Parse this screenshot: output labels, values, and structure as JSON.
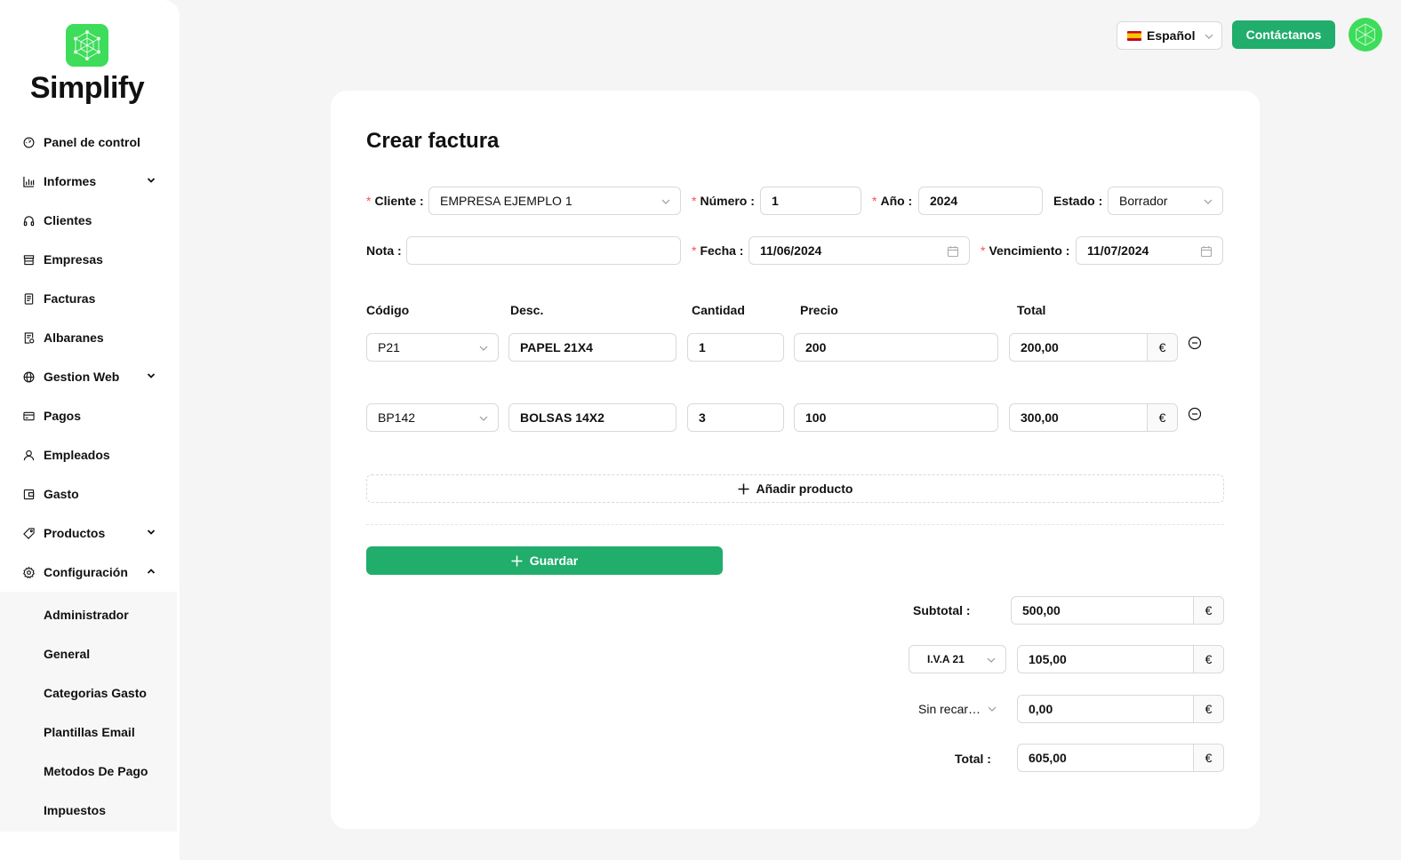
{
  "app": {
    "name": "Simplify"
  },
  "sidebar": {
    "items": [
      {
        "label": "Panel de control",
        "icon": "dashboard-icon",
        "expandable": false
      },
      {
        "label": "Informes",
        "icon": "bar-chart-icon",
        "expandable": true
      },
      {
        "label": "Clientes",
        "icon": "headphones-icon",
        "expandable": false
      },
      {
        "label": "Empresas",
        "icon": "shop-icon",
        "expandable": false
      },
      {
        "label": "Facturas",
        "icon": "invoice-icon",
        "expandable": false
      },
      {
        "label": "Albaranes",
        "icon": "delivery-note-icon",
        "expandable": false
      },
      {
        "label": "Gestion Web",
        "icon": "globe-icon",
        "expandable": true
      },
      {
        "label": "Pagos",
        "icon": "credit-card-icon",
        "expandable": false
      },
      {
        "label": "Empleados",
        "icon": "user-icon",
        "expandable": false
      },
      {
        "label": "Gasto",
        "icon": "wallet-icon",
        "expandable": false
      },
      {
        "label": "Productos",
        "icon": "tag-icon",
        "expandable": true
      },
      {
        "label": "Configuración",
        "icon": "settings-icon",
        "expandable": true,
        "expanded": true
      }
    ],
    "submenu": [
      "Administrador",
      "General",
      "Categorias Gasto",
      "Plantillas Email",
      "Metodos De Pago",
      "Impuestos"
    ]
  },
  "topbar": {
    "language": "Español",
    "contact_label": "Contáctanos"
  },
  "form": {
    "title": "Crear factura",
    "cliente_label": "Cliente",
    "cliente_value": "EMPRESA EJEMPLO 1",
    "numero_label": "Número",
    "numero_value": "1",
    "anio_label": "Año",
    "anio_value": "2024",
    "estado_label": "Estado",
    "estado_value": "Borrador",
    "nota_label": "Nota",
    "nota_value": "",
    "fecha_label": "Fecha",
    "fecha_value": "11/06/2024",
    "vencimiento_label": "Vencimiento",
    "vencimiento_value": "11/07/2024",
    "colon": ":"
  },
  "lines": {
    "headers": {
      "codigo": "Código",
      "desc": "Desc.",
      "cantidad": "Cantidad",
      "precio": "Precio",
      "total": "Total"
    },
    "rows": [
      {
        "codigo": "P21",
        "desc": "PAPEL 21X4",
        "cantidad": "1",
        "precio": "200",
        "total": "200,00"
      },
      {
        "codigo": "BP142",
        "desc": "BOLSAS 14X2",
        "cantidad": "3",
        "precio": "100",
        "total": "300,00"
      }
    ],
    "currency": "€",
    "add_product_label": "Añadir producto"
  },
  "actions": {
    "save_label": "Guardar"
  },
  "summary": {
    "subtotal_label": "Subtotal :",
    "subtotal_value": "500,00",
    "iva_select": "I.V.A 21",
    "iva_value": "105,00",
    "recargo_select": "Sin recar…",
    "recargo_value": "0,00",
    "total_label": "Total :",
    "total_value": "605,00",
    "currency": "€"
  },
  "colors": {
    "accent": "#21ad6c",
    "logo": "#3ddc5a",
    "required": "#ff4d4f"
  }
}
